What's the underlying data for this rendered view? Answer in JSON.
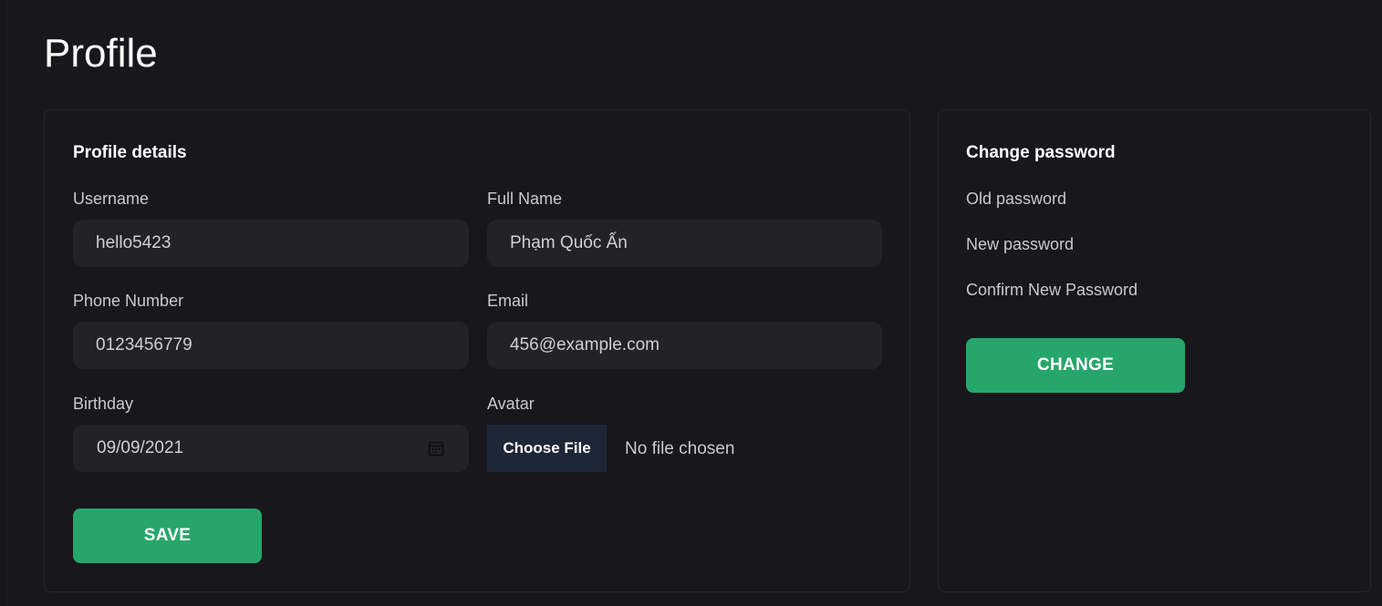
{
  "page": {
    "title": "Profile"
  },
  "profile_card": {
    "title": "Profile details",
    "username": {
      "label": "Username",
      "value": "hello5423"
    },
    "full_name": {
      "label": "Full Name",
      "value": "Phạm Quốc Ấn"
    },
    "phone": {
      "label": "Phone Number",
      "value": "0123456779"
    },
    "email": {
      "label": "Email",
      "value": "456@example.com"
    },
    "birthday": {
      "label": "Birthday",
      "value": "09/09/2021",
      "icon": "calendar-icon"
    },
    "avatar": {
      "label": "Avatar",
      "button_label": "Choose File",
      "status": "No file chosen"
    },
    "save_label": "SAVE"
  },
  "password_card": {
    "title": "Change password",
    "old_password_label": "Old password",
    "new_password_label": "New password",
    "confirm_password_label": "Confirm New Password",
    "change_label": "CHANGE"
  },
  "colors": {
    "background": "#17171c",
    "input_bg": "#222227",
    "accent_green": "#26a66a",
    "file_button_bg": "#1e2736",
    "card_border": "#26262d"
  }
}
